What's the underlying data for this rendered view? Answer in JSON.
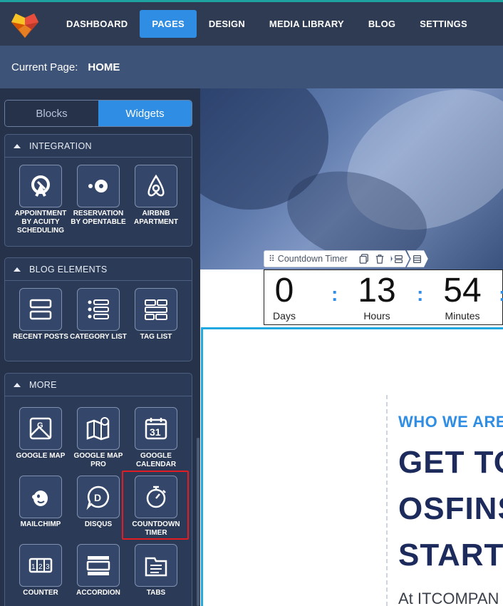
{
  "nav": {
    "items": [
      {
        "label": "DASHBOARD",
        "active": false
      },
      {
        "label": "PAGES",
        "active": true
      },
      {
        "label": "DESIGN",
        "active": false
      },
      {
        "label": "MEDIA LIBRARY",
        "active": false
      },
      {
        "label": "BLOG",
        "active": false
      },
      {
        "label": "SETTINGS",
        "active": false
      }
    ]
  },
  "current_page": {
    "label": "Current Page:",
    "value": "HOME"
  },
  "sidebar": {
    "tabs": [
      {
        "label": "Blocks",
        "active": false
      },
      {
        "label": "Widgets",
        "active": true
      }
    ],
    "sections": {
      "integration": {
        "title": "INTEGRATION",
        "widgets": [
          {
            "label": "APPOINTMENT BY ACUITY SCHEDULING",
            "icon": "acuity-icon"
          },
          {
            "label": "RESERVATION BY OPENTABLE",
            "icon": "opentable-icon"
          },
          {
            "label": "AIRBNB APARTMENT",
            "icon": "airbnb-icon"
          }
        ]
      },
      "blog": {
        "title": "BLOG ELEMENTS",
        "widgets": [
          {
            "label": "RECENT POSTS",
            "icon": "recent-posts-icon"
          },
          {
            "label": "CATEGORY LIST",
            "icon": "category-list-icon"
          },
          {
            "label": "TAG LIST",
            "icon": "tag-list-icon"
          }
        ]
      },
      "more": {
        "title": "MORE",
        "widgets": [
          {
            "label": "GOOGLE MAP",
            "icon": "google-map-icon"
          },
          {
            "label": "GOOGLE MAP PRO",
            "icon": "google-map-pro-icon"
          },
          {
            "label": "GOOGLE CALENDAR",
            "icon": "google-calendar-icon"
          },
          {
            "label": "MAILCHIMP",
            "icon": "mailchimp-icon"
          },
          {
            "label": "DISQUS",
            "icon": "disqus-icon"
          },
          {
            "label": "COUNTDOWN TIMER",
            "icon": "stopwatch-icon"
          },
          {
            "label": "COUNTER",
            "icon": "counter-icon"
          },
          {
            "label": "ACCORDION",
            "icon": "accordion-icon"
          },
          {
            "label": "TABS",
            "icon": "tabs-icon"
          }
        ]
      }
    },
    "calendar_day": "31"
  },
  "content": {
    "toolbar_label": "Countdown Timer",
    "countdown": {
      "days": {
        "value": "0",
        "label": "Days"
      },
      "hours": {
        "value": "13",
        "label": "Hours"
      },
      "minutes": {
        "value": "54",
        "label": "Minutes"
      },
      "separator": ":"
    },
    "who_we_are": "WHO WE ARE",
    "headline": [
      "GET TO",
      "OSFINS",
      "STARTU"
    ],
    "paragraph": "At ITCOMPAN"
  },
  "colors": {
    "accent": "#2f8ee3",
    "highlight": "#e21c22",
    "nav_bg": "#2e3b52"
  }
}
